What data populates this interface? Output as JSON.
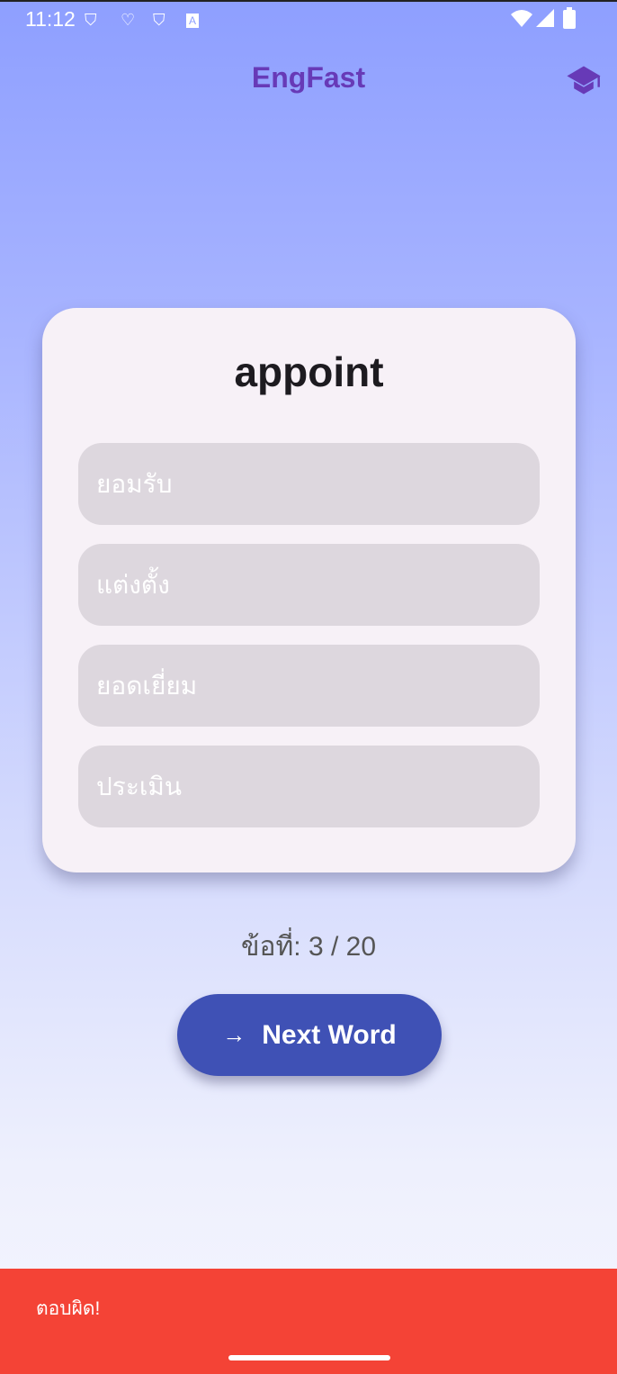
{
  "status_bar": {
    "time": "11:12",
    "icons": [
      "shield-icon",
      "accessibility-icon",
      "shield-icon",
      "font-icon",
      "wifi-icon",
      "signal-icon",
      "battery-icon"
    ]
  },
  "app_bar": {
    "title": "EngFast",
    "action_icon": "graduation-cap-icon"
  },
  "quiz": {
    "word": "appoint",
    "options": [
      {
        "label": "ยอมรับ"
      },
      {
        "label": "แต่งตั้ง"
      },
      {
        "label": "ยอดเยี่ยม"
      },
      {
        "label": "ประเมิน"
      }
    ],
    "counter": "ข้อที่: 3 / 20",
    "next_label": "Next Word"
  },
  "snackbar": {
    "message": "ตอบผิด!"
  },
  "colors": {
    "accent": "#3f51b5",
    "title": "#673ab7",
    "error": "#f44336"
  }
}
